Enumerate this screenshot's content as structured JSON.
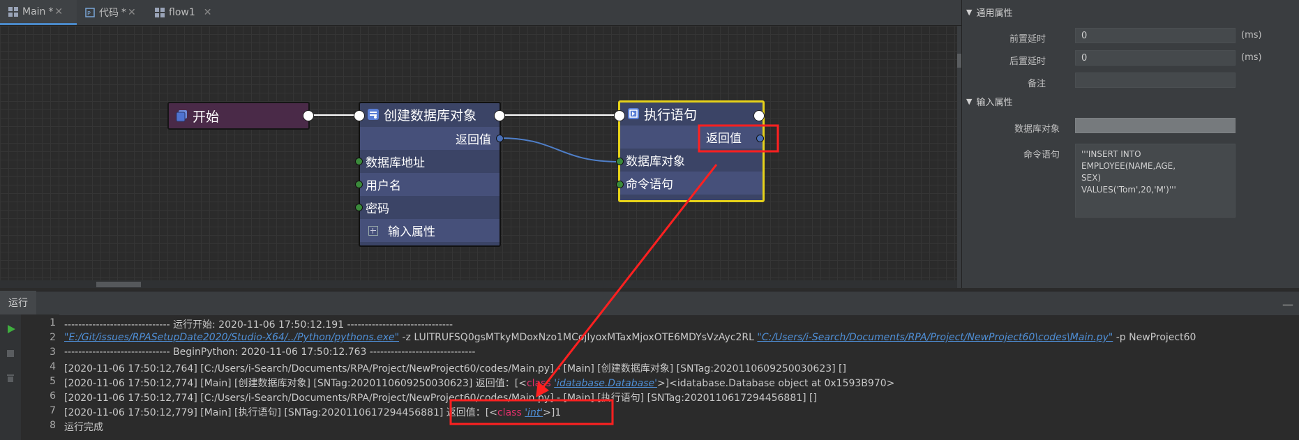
{
  "tabs": [
    {
      "label": "Main",
      "modified": "*",
      "close": "✕"
    },
    {
      "label": "代码",
      "modified": "*",
      "close": "✕"
    },
    {
      "label": "flow1",
      "modified": "",
      "close": "✕"
    }
  ],
  "nodes": {
    "start": {
      "title": "开始"
    },
    "create_db": {
      "title": "创建数据库对象",
      "output": "返回值",
      "inputs": [
        "数据库地址",
        "用户名",
        "密码"
      ],
      "expand": "输入属性"
    },
    "exec": {
      "title": "执行语句",
      "output": "返回值",
      "inputs": [
        "数据库对象",
        "命令语句"
      ]
    }
  },
  "panel": {
    "general_section": "通用属性",
    "pre_delay_label": "前置延时",
    "pre_delay_value": "0",
    "post_delay_label": "后置延时",
    "post_delay_value": "0",
    "unit": "(ms)",
    "note_label": "备注",
    "note_value": "",
    "input_section": "输入属性",
    "db_obj_label": "数据库对象",
    "cmd_label": "命令语句",
    "cmd_value_line1": "'''INSERT INTO EMPLOYEE(NAME,AGE,",
    "cmd_value_line2": "SEX)",
    "cmd_value_line3": "VALUES('Tom',20,'M')'''"
  },
  "console": {
    "tab": "运行",
    "minimize": "—",
    "lines": [
      {
        "n": "1",
        "text": "------------------------------ 运行开始: 2020-11-06 17:50:12.191 ------------------------------"
      },
      {
        "n": "2",
        "link1": "\"E:/Git/issues/RPASetupDate2020/Studio-X64/../Python/pythons.exe\"",
        "mid": "  -z LUlTRUFSQ0gsMTkyMDoxNzo1MCojIyoxMTaxMjoxOTE6MDYsVzAyc2RL ",
        "link2": "\"C:/Users/i-Search/Documents/RPA/Project/NewProject60\\codes\\Main.py\"",
        "tail": " -p  NewProject60"
      },
      {
        "n": "3",
        "text": "------------------------------ BeginPython: 2020-11-06 17:50:12.763 ------------------------------"
      },
      {
        "n": "4",
        "text": "[2020-11-06 17:50:12,764] [C:/Users/i-Search/Documents/RPA/Project/NewProject60/codes/Main.py] - [Main] [创建数据库对象] [SNTag:2020110609250030623] []"
      },
      {
        "n": "5",
        "pre": "[2020-11-06 17:50:12,774] [Main] [创建数据库对象] [SNTag:2020110609250030623]  返回值：[<",
        "kw": "class",
        "sp": " ",
        "lnk": "'idatabase.Database'",
        "post": ">]<idatabase.Database object at 0x1593B970>"
      },
      {
        "n": "6",
        "text": "[2020-11-06 17:50:12,774] [C:/Users/i-Search/Documents/RPA/Project/NewProject60/codes/Main.py] - [Main] [执行语句] [SNTag:2020110617294456881] []"
      },
      {
        "n": "7",
        "pre": "[2020-11-06 17:50:12,779] [Main] [执行语句] [SNTag:2020110617294456881]  返回值：[<",
        "kw": "class",
        "sp": " ",
        "lnk": "'int'",
        "post": ">]1"
      },
      {
        "n": "8",
        "text": "运行完成"
      }
    ]
  },
  "colors": {
    "accent": "#4a88c7",
    "highlight": "#ff2020",
    "node_selected": "#e6d21a"
  }
}
